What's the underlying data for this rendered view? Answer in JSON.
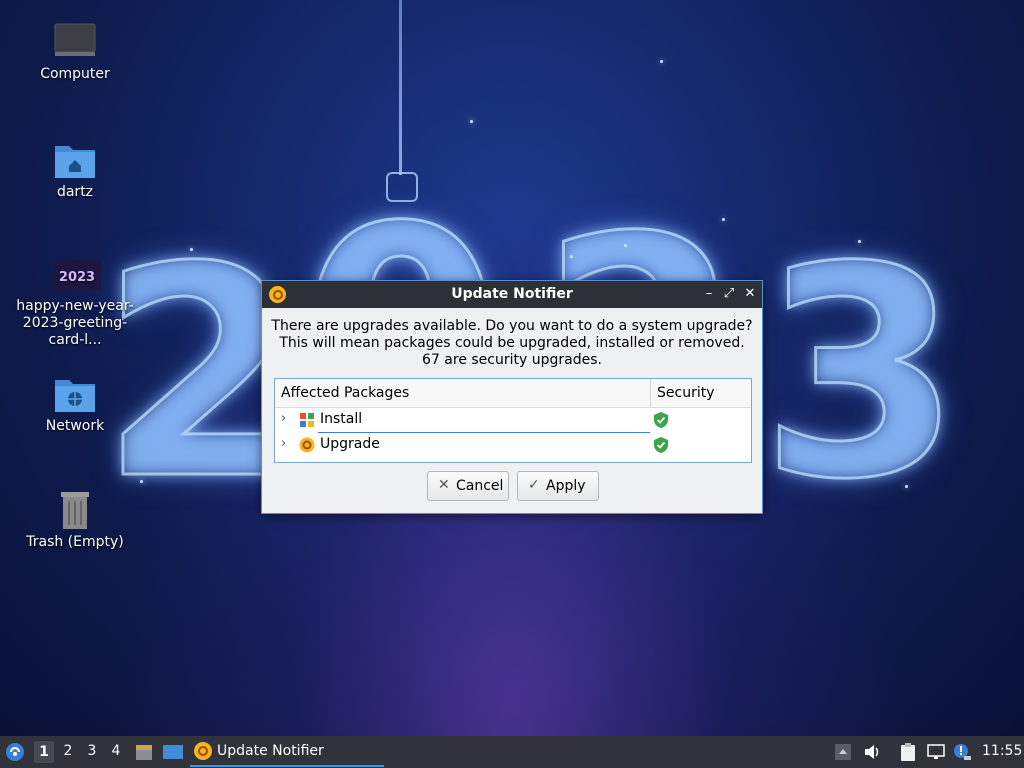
{
  "desktop": {
    "wallpaper_digits": [
      "2",
      "0",
      "2",
      "3"
    ],
    "icons": [
      {
        "label": "Computer",
        "icon": "computer-icon"
      },
      {
        "label": "dartz",
        "icon": "home-folder-icon"
      },
      {
        "label": "happy-new-year-2023-greeting-card-l...",
        "icon": "image-file-icon",
        "thumb_text": "2023"
      },
      {
        "label": "Network",
        "icon": "network-folder-icon"
      },
      {
        "label": "Trash (Empty)",
        "icon": "trash-icon"
      }
    ]
  },
  "dialog": {
    "title": "Update Notifier",
    "message": [
      "There are upgrades available. Do you want to do a system upgrade?",
      "This will mean packages could be upgraded, installed or removed.",
      "67 are security upgrades."
    ],
    "columns": [
      "Affected Packages",
      "Security"
    ],
    "rows": [
      {
        "label": "Install",
        "icon": "install-icon",
        "security": "shield-check-icon"
      },
      {
        "label": "Upgrade",
        "icon": "upgrade-icon",
        "security": "shield-check-icon"
      }
    ],
    "buttons": {
      "cancel": "Cancel",
      "apply": "Apply"
    },
    "window_controls": {
      "minimize": "–",
      "maximize": "⤢",
      "close": "✕"
    }
  },
  "taskbar": {
    "workspaces": [
      "1",
      "2",
      "3",
      "4"
    ],
    "active_workspace": "1",
    "task_label": "Update Notifier",
    "clock": "11:55"
  },
  "colors": {
    "accent": "#4a90d9",
    "security_green": "#3aa54a",
    "updater_orange": "#f5b51d"
  }
}
